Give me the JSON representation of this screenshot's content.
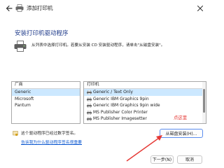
{
  "window": {
    "title": "添加打印机",
    "close_glyph": "✕"
  },
  "header": {
    "heading": "安装打印机驱动程序",
    "description": "从列表中选择打印机。若要从安装 CD 安装驱动程序，请单击\"从磁盘安装\"。"
  },
  "manufacturer_list": {
    "header": "厂商",
    "items": [
      "Generic",
      "Microsoft",
      "Pantum"
    ],
    "selected": "Generic"
  },
  "printer_list": {
    "header": "打印机",
    "items": [
      "Generic / Text Only",
      "Generic IBM Graphics 9pin",
      "Generic IBM Graphics 9pin wide",
      "MS Publisher Color Printer",
      "MS Publisher Imagesetter"
    ],
    "selected": "Generic / Text Only"
  },
  "signed_notice": "这个驱动程序已经过数字签名。",
  "sign_link": "告诉我为什么驱动程序签名很重要",
  "buttons": {
    "have_disk": "从磁盘安装(H)...",
    "next": "下一步(N)",
    "cancel": "取消"
  },
  "annotation": {
    "text": "点这里",
    "color": "#e53935"
  },
  "colors": {
    "heading": "#1e3a8a",
    "link": "#0b57d0",
    "selection": "#cce8ff",
    "button_focus": "#5b8def"
  },
  "icons": {
    "back": "back-arrow-icon",
    "title": "printer-icon",
    "close": "close-icon",
    "header": "printer-icon",
    "signed": "certificate-icon",
    "printer_item": "printer-icon"
  }
}
